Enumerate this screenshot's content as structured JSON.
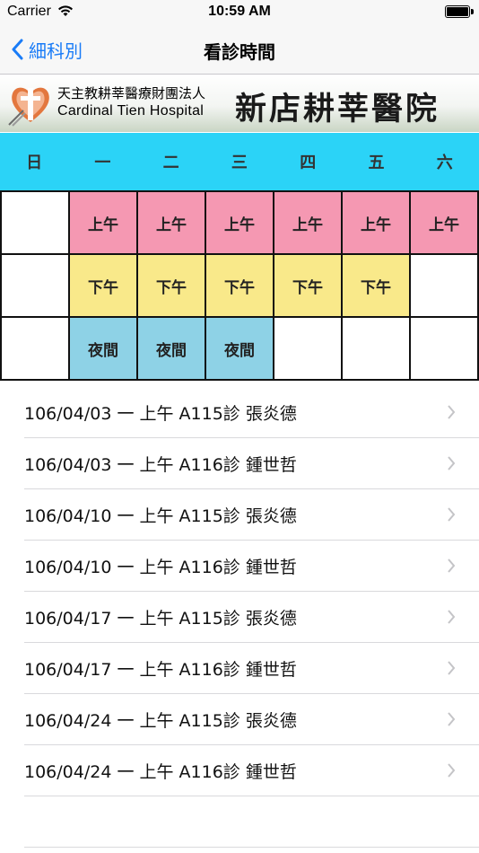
{
  "status": {
    "carrier": "Carrier",
    "time": "10:59 AM"
  },
  "nav": {
    "back_label": "細科別",
    "title": "看診時間"
  },
  "banner": {
    "org_cn": "天主教耕莘醫療財團法人",
    "org_en": "Cardinal Tien Hospital",
    "hospital_name": "新店耕莘醫院"
  },
  "schedule": {
    "days": [
      "日",
      "一",
      "二",
      "三",
      "四",
      "五",
      "六"
    ],
    "rows": [
      [
        "",
        "上午",
        "上午",
        "上午",
        "上午",
        "上午",
        "上午"
      ],
      [
        "",
        "下午",
        "下午",
        "下午",
        "下午",
        "下午",
        ""
      ],
      [
        "",
        "夜間",
        "夜間",
        "夜間",
        "",
        "",
        ""
      ]
    ]
  },
  "colors": {
    "header": "#2bd3f7",
    "morning": "#f598b2",
    "afternoon": "#f9e98a",
    "night": "#8ed2e6",
    "accent": "#1a7cf7"
  },
  "appointments": [
    "106/04/03 一 上午 A115診 張炎德",
    "106/04/03 一 上午 A116診 鍾世哲",
    "106/04/10 一 上午 A115診 張炎德",
    "106/04/10 一 上午 A116診 鍾世哲",
    "106/04/17 一 上午 A115診 張炎德",
    "106/04/17 一 上午 A116診 鍾世哲",
    "106/04/24 一 上午 A115診 張炎德",
    "106/04/24 一 上午 A116診 鍾世哲"
  ]
}
